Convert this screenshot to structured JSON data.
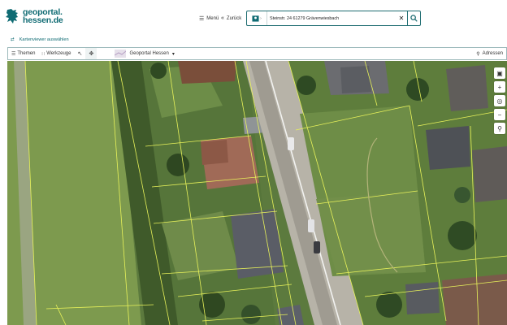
{
  "header": {
    "logo_line1": "geoportal.",
    "logo_line2": "hessen.de",
    "menu_label": "Menü",
    "back_label": "Zurück"
  },
  "search": {
    "value": "Steinstr. 24 61279 Grävenwiesbach",
    "clear_icon": "close-icon",
    "submit_icon": "search-icon"
  },
  "kartenviewer": {
    "label": "Kartenviewer auswählen"
  },
  "toolbar": {
    "themen": "Themen",
    "werkzeuge": "Werkzeuge",
    "geoportal_label": "Geoportal Hessen",
    "adressen": "Adressen"
  },
  "map_controls": [
    "monitor-icon",
    "zoom-in-icon",
    "compass-icon",
    "zoom-out-icon",
    "search-zoom-icon"
  ],
  "colors": {
    "brand": "#0f6b73",
    "parcel_lines": "#e8f25a",
    "accent_border": "#1f6d72"
  }
}
